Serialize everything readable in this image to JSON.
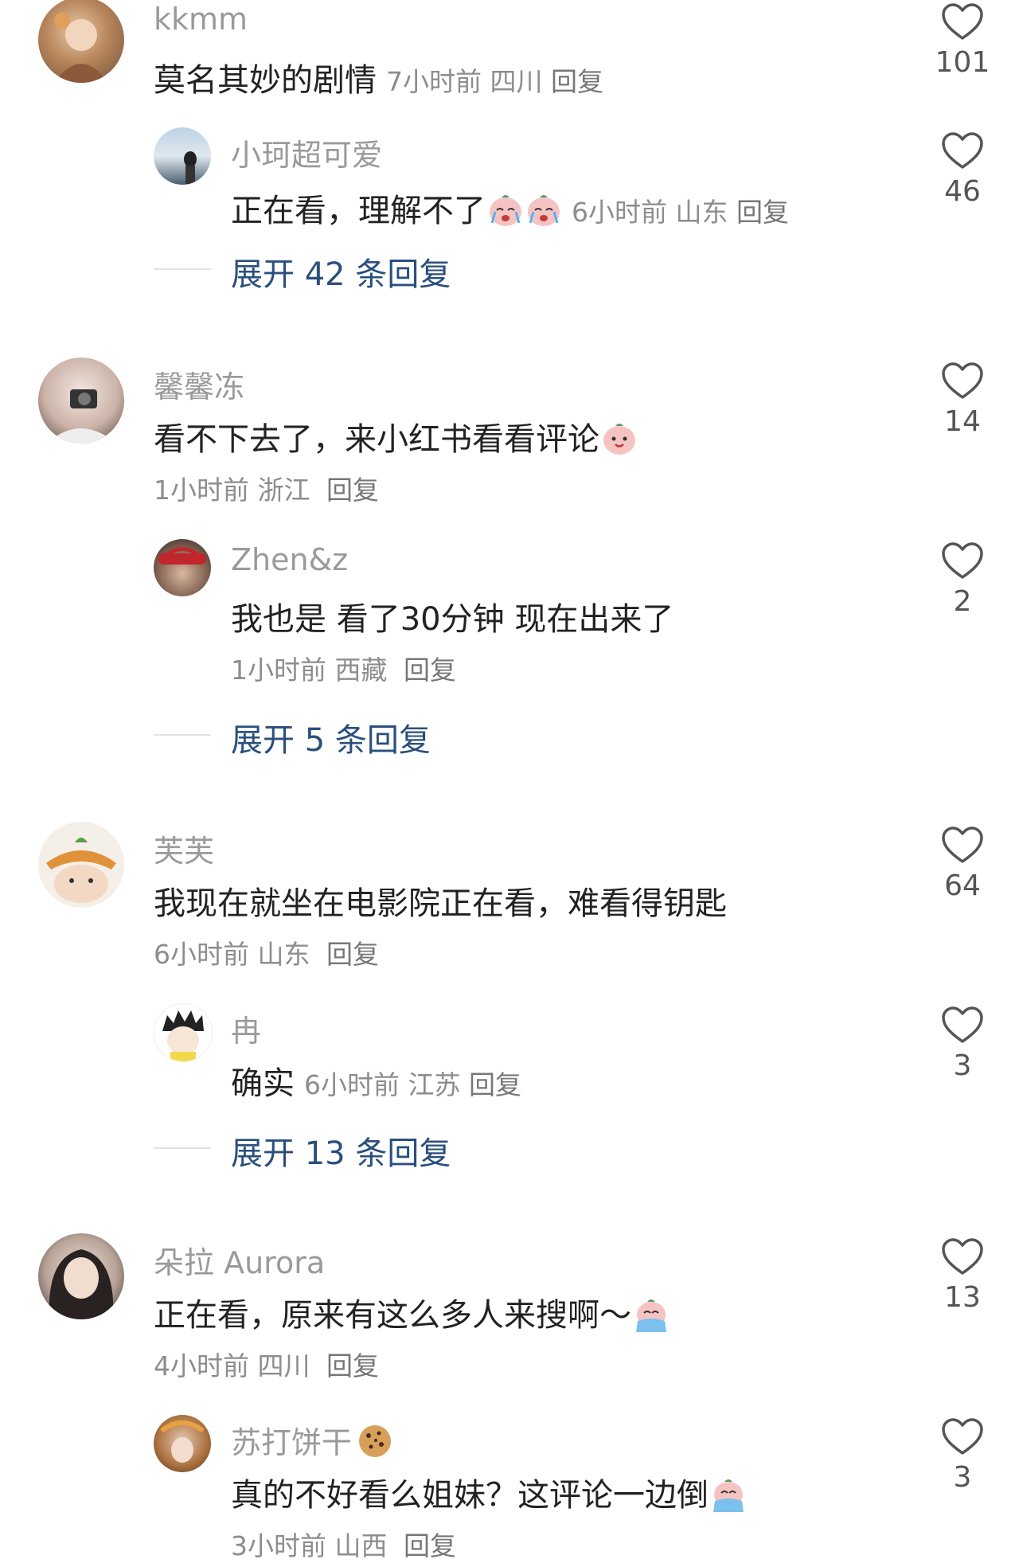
{
  "comments": [
    {
      "user": "kkmm",
      "text": "莫名其妙的剧情",
      "time": "7小时前",
      "location": "四川",
      "reply_label": "回复",
      "likes": "101",
      "reply": {
        "user": "小珂超可爱",
        "text": "正在看，理解不了",
        "time": "6小时前",
        "location": "山东",
        "reply_label": "回复",
        "likes": "46"
      },
      "expand": "展开 42 条回复"
    },
    {
      "user": "馨馨冻",
      "text": "看不下去了，来小红书看看评论",
      "time": "1小时前",
      "location": "浙江",
      "reply_label": "回复",
      "likes": "14",
      "reply": {
        "user": "Zhen&z",
        "text": "我也是 看了30分钟 现在出来了",
        "time": "1小时前",
        "location": "西藏",
        "reply_label": "回复",
        "likes": "2"
      },
      "expand": "展开 5 条回复"
    },
    {
      "user": "芙芙",
      "text": "我现在就坐在电影院正在看，难看得钥匙",
      "time": "6小时前",
      "location": "山东",
      "reply_label": "回复",
      "likes": "64",
      "reply": {
        "user": "冉",
        "text": "确实",
        "time": "6小时前",
        "location": "江苏",
        "reply_label": "回复",
        "likes": "3"
      },
      "expand": "展开 13 条回复"
    },
    {
      "user": "朵拉 Aurora",
      "text": "正在看，原来有这么多人来搜啊～",
      "time": "4小时前",
      "location": "四川",
      "reply_label": "回复",
      "likes": "13",
      "reply": {
        "user": "苏打饼干",
        "text": "真的不好看么姐妹？这评论一边倒",
        "time": "3小时前",
        "location": "山西",
        "reply_label": "回复",
        "likes": "3"
      }
    }
  ],
  "colors": {
    "username": "#9a9a9a",
    "meta": "#8d8d8d",
    "expand_link": "#2a4f7c",
    "heart_stroke": "#555555"
  }
}
